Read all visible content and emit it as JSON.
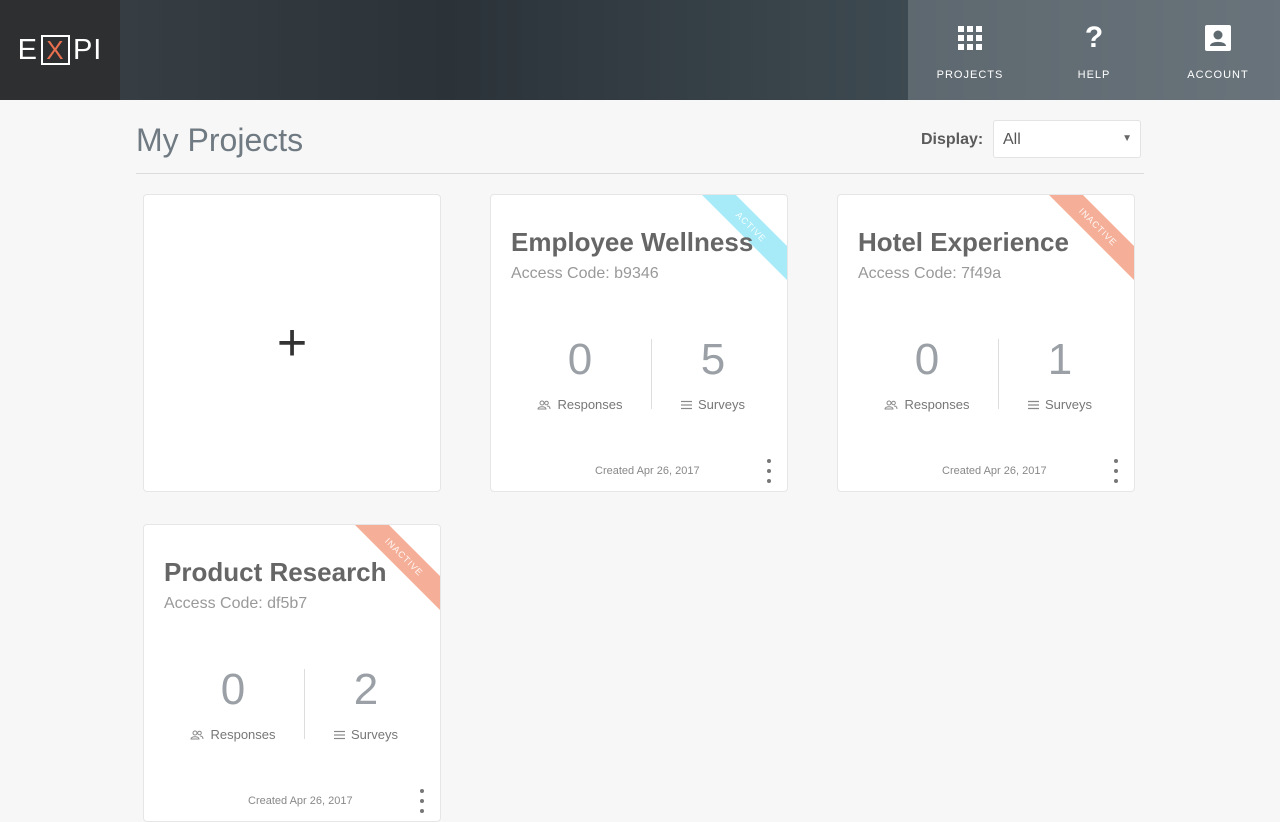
{
  "app": {
    "logo_left": "E",
    "logo_x": "X",
    "logo_right": "PI"
  },
  "nav": {
    "items": [
      {
        "label": "PROJECTS",
        "icon": "grid-icon"
      },
      {
        "label": "HELP",
        "icon": "question-icon"
      },
      {
        "label": "ACCOUNT",
        "icon": "account-icon"
      }
    ]
  },
  "page": {
    "title": "My Projects",
    "display_label": "Display:",
    "display_value": "All",
    "new_project_symbol": "+"
  },
  "colors": {
    "active": "#a7ebf8",
    "inactive": "#f5af98",
    "logo_x": "#e8704f"
  },
  "projects": [
    {
      "name": "Employee Wellness",
      "status": "ACTIVE",
      "access_code": "Access Code: b9346",
      "responses": "0",
      "responses_label": "Responses",
      "surveys": "5",
      "surveys_label": "Surveys",
      "created": "Created Apr 26, 2017"
    },
    {
      "name": "Hotel Experience",
      "status": "INACTIVE",
      "access_code": "Access Code: 7f49a",
      "responses": "0",
      "responses_label": "Responses",
      "surveys": "1",
      "surveys_label": "Surveys",
      "created": "Created Apr 26, 2017"
    },
    {
      "name": "Product Research",
      "status": "INACTIVE",
      "access_code": "Access Code: df5b7",
      "responses": "0",
      "responses_label": "Responses",
      "surveys": "2",
      "surveys_label": "Surveys",
      "created": "Created Apr 26, 2017"
    }
  ]
}
